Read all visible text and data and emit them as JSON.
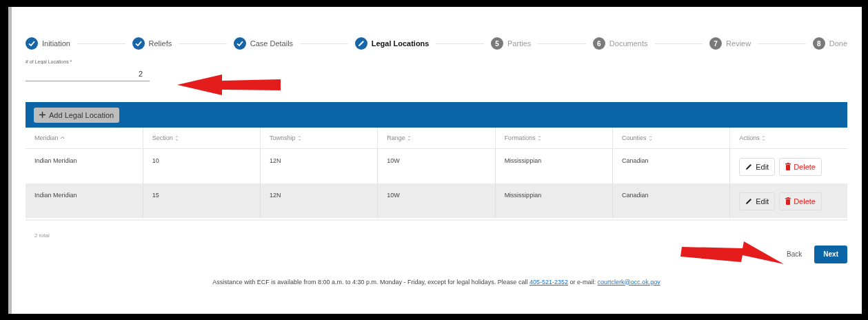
{
  "steps": [
    {
      "label": "Initiation",
      "completed": true,
      "current": false
    },
    {
      "label": "Reliefs",
      "completed": true,
      "current": false
    },
    {
      "label": "Case Details",
      "completed": true,
      "current": false
    },
    {
      "label": "Legal Locations",
      "completed": false,
      "current": true
    },
    {
      "number": "5",
      "label": "Parties",
      "completed": false,
      "current": false
    },
    {
      "number": "6",
      "label": "Documents",
      "completed": false,
      "current": false
    },
    {
      "number": "7",
      "label": "Review",
      "completed": false,
      "current": false
    },
    {
      "number": "8",
      "label": "Done",
      "completed": false,
      "current": false
    }
  ],
  "count_field": {
    "label": "# of Legal Locations *",
    "value": "2"
  },
  "toolbar": {
    "add_button": "Add Legal Location"
  },
  "table": {
    "columns": [
      {
        "label": "Meridian",
        "sorted": true
      },
      {
        "label": "Section",
        "sorted": false
      },
      {
        "label": "Township",
        "sorted": false
      },
      {
        "label": "Range",
        "sorted": false
      },
      {
        "label": "Formations",
        "sorted": false
      },
      {
        "label": "Counties",
        "sorted": false
      },
      {
        "label": "Actions",
        "sorted": false
      }
    ],
    "rows": [
      {
        "cells": [
          "Indian Meridian",
          "10",
          "12N",
          "10W",
          "Mississippian",
          "Canadian"
        ],
        "edit": "Edit",
        "delete": "Delete"
      },
      {
        "cells": [
          "Indian Meridian",
          "15",
          "12N",
          "10W",
          "Mississippian",
          "Canadian"
        ],
        "edit": "Edit",
        "delete": "Delete"
      }
    ],
    "total": "2 total"
  },
  "nav": {
    "back": "Back",
    "next": "Next"
  },
  "footer": {
    "text": "Assistance with ECF is available from 8:00 a.m. to 4:30 p.m. Monday - Friday, except for legal holidays. Please call",
    "phone": "405-521-2352",
    "middle": "or e-mail:",
    "email": "courtclerk@occ.ok.gov"
  },
  "annotations": {
    "field_arrow": true,
    "next_arrow": true
  }
}
